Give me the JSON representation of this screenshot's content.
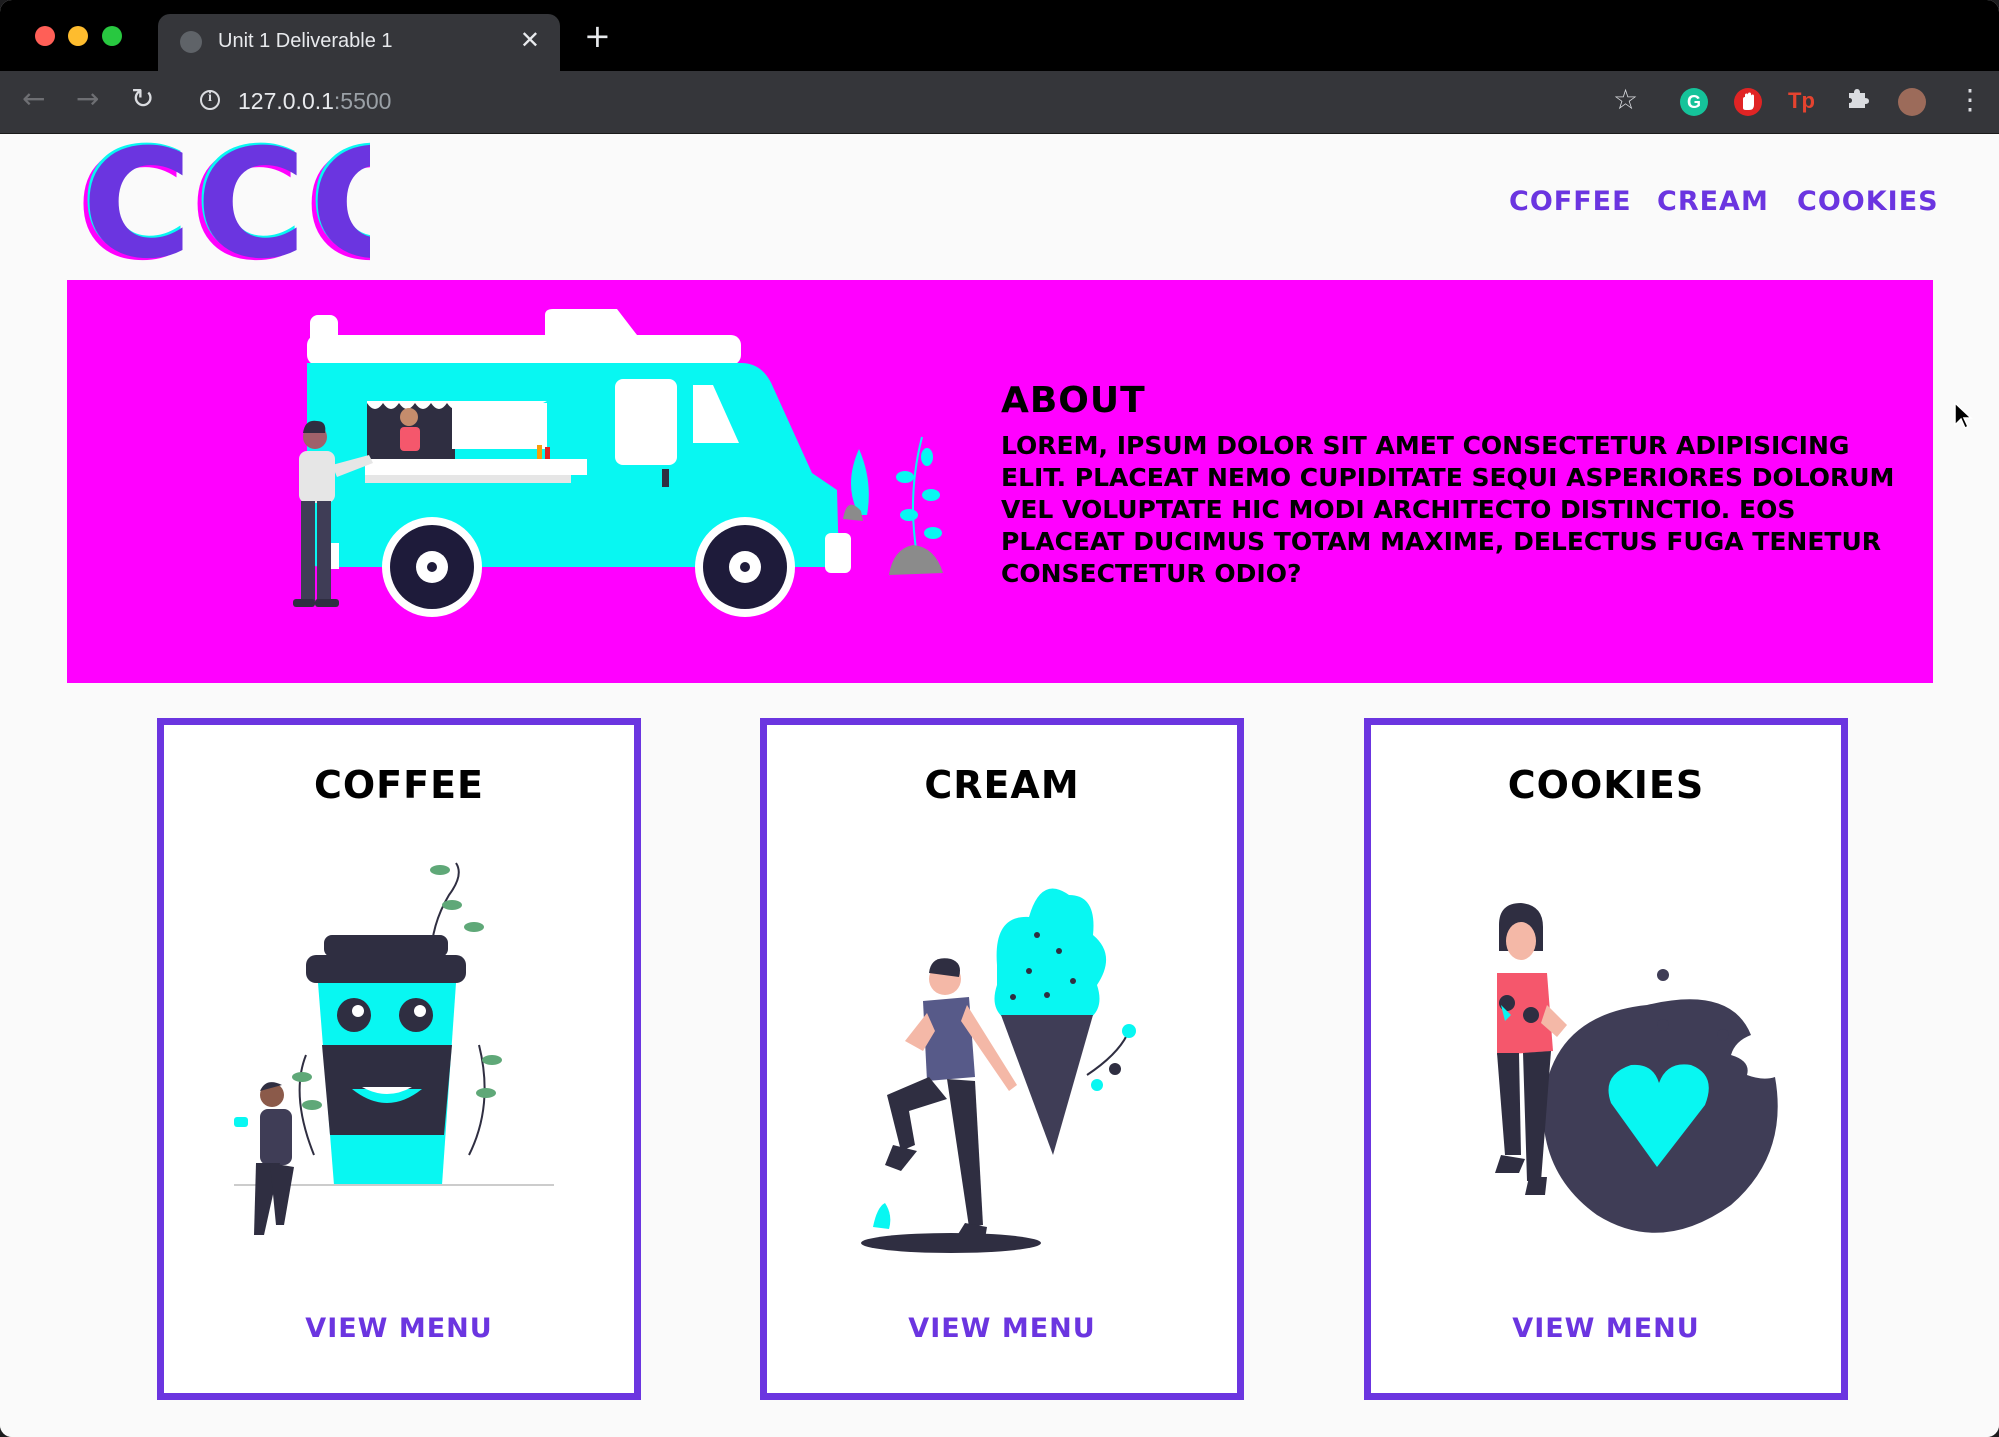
{
  "browser": {
    "tab_title": "Unit 1 Deliverable 1",
    "tab_close": "✕",
    "new_tab": "+",
    "url_host": "127.0.0.1",
    "url_port": ":5500",
    "back": "←",
    "forward": "→",
    "reload": "↻",
    "star": "☆",
    "menu": "⋮",
    "grammarly": "G",
    "tp": "Tp",
    "puzzle": "✧"
  },
  "header": {
    "logo_text": "CCC",
    "nav": [
      "COFFEE",
      "CREAM",
      "COOKIES"
    ]
  },
  "hero": {
    "title": "ABOUT",
    "body": "Lorem, ipsum dolor sit amet consectetur adipisicing elit. Placeat nemo cupiditate sequi asperiores dolorum vel voluptate hic modi architecto distinctio. Eos placeat ducimus totam maxime, delectus fuga tenetur consectetur odio?"
  },
  "cards": [
    {
      "title": "COFFEE",
      "link": "VIEW MENU"
    },
    {
      "title": "CREAM",
      "link": "VIEW MENU"
    },
    {
      "title": "COOKIES",
      "link": "VIEW MENU"
    }
  ],
  "colors": {
    "accent": "#6b35e0",
    "hero_bg": "#ff00ff",
    "cyan": "#08f7f2",
    "dark": "#2f2e41"
  }
}
